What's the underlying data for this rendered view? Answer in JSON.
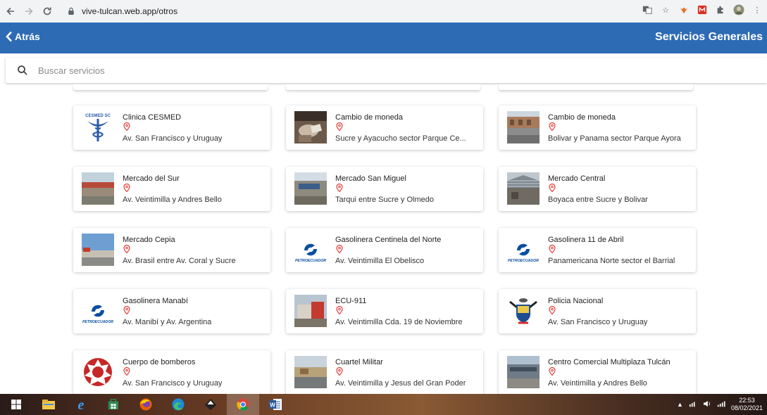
{
  "browser": {
    "url": "vive-tulcan.web.app/otros"
  },
  "header": {
    "back_label": "Atrás",
    "title": "Servicios Generales",
    "color": "#2e6bb5"
  },
  "search": {
    "placeholder": "Buscar servicios"
  },
  "cards": [
    {
      "title": "Clinica CESMED",
      "address": "Av. San Francisco y Uruguay",
      "thumb": "cesmed-logo",
      "logo_text": "CESMED SC"
    },
    {
      "title": "Cambio de moneda",
      "address": "Sucre y Ayacucho sector Parque Ce...",
      "thumb": "photo-money"
    },
    {
      "title": "Cambio de moneda",
      "address": "Bolivar y Panama sector Parque Ayora",
      "thumb": "photo-street"
    },
    {
      "title": "Mercado del Sur",
      "address": "Av. Veintimilla y Andres Bello",
      "thumb": "photo-market"
    },
    {
      "title": "Mercado San Miguel",
      "address": "Tarqui entre Sucre y Olmedo",
      "thumb": "photo-building"
    },
    {
      "title": "Mercado Central",
      "address": "Boyaca entre Sucre y Bolivar",
      "thumb": "photo-roof"
    },
    {
      "title": "Mercado Cepia",
      "address": "Av. Brasil entre Av. Coral y Sucre",
      "thumb": "photo-sky"
    },
    {
      "title": "Gasolinera Centinela del Norte",
      "address": "Av. Veintimilla El Obelisco",
      "thumb": "petroecuador-logo",
      "logo_text": "PETROECUADOR"
    },
    {
      "title": "Gasolinera 11 de Abril",
      "address": "Panamericana Norte sector el Barrial",
      "thumb": "petroecuador-logo",
      "logo_text": "PETROECUADOR"
    },
    {
      "title": "Gasolinera Manabí",
      "address": "Av. Manibí y Av. Argentina",
      "thumb": "petroecuador-logo",
      "logo_text": "PETROECUADOR"
    },
    {
      "title": "ECU-911",
      "address": "Av. Veintimilla Cda. 19 de Noviembre",
      "thumb": "photo-ecu"
    },
    {
      "title": "Policia Nacional",
      "address": "Av. San Francisco y Uruguay",
      "thumb": "ecuador-shield-logo"
    },
    {
      "title": "Cuerpo de bomberos",
      "address": "Av. San Francisco y Uruguay",
      "thumb": "firefighter-logo"
    },
    {
      "title": "Cuartel Militar",
      "address": "Av. Veintimilla y Jesus del Gran Poder",
      "thumb": "photo-military"
    },
    {
      "title": "Centro Comercial Multiplaza Tulcán",
      "address": "Av. Veintimilla y Andres Bello",
      "thumb": "photo-mall"
    }
  ],
  "taskbar": {
    "time": "22:53",
    "date": "08/02/2021"
  }
}
